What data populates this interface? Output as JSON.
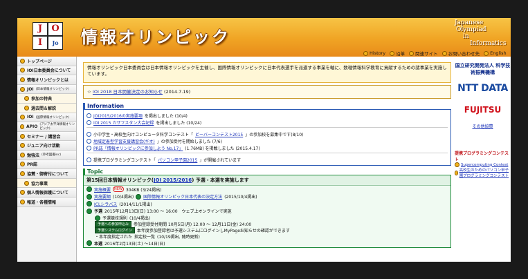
{
  "header": {
    "logo_letters": [
      "J",
      "O",
      "I"
    ],
    "logo_small": "Jo",
    "site_title": "情報オリンピック",
    "en_title": [
      "Japanese",
      "Olympiad",
      "in",
      "Informatics"
    ]
  },
  "topnav": [
    "History",
    "沿革",
    "関連サイト",
    "お問い合わせ先",
    "English"
  ],
  "sidebar": {
    "items": [
      {
        "label": "トップページ",
        "sub": false
      },
      {
        "label": "IOI日本委員会について",
        "sub": false
      },
      {
        "label": "情報オリンピックとは",
        "sub": false
      },
      {
        "label": "JOI",
        "small": "(日本情報オリンピック)",
        "sub": false
      },
      {
        "label": "参加の特典",
        "sub": true
      },
      {
        "label": "過去問＆解説",
        "sub": true
      },
      {
        "label": "IOI",
        "small": "(国際情報オリンピック)",
        "sub": false
      },
      {
        "label": "APIO",
        "small": "(アジア太平洋情報オリンピック)",
        "sub": false
      },
      {
        "label": "セミナー / 講習会",
        "sub": false
      },
      {
        "label": "ジュニア向け活動",
        "sub": false
      },
      {
        "label": "勉強法",
        "small": "(参考図書inc)",
        "sub": false
      },
      {
        "label": "PR誌",
        "sub": false
      },
      {
        "label": "協賛・御寄付について",
        "sub": false
      },
      {
        "label": "協力事業",
        "sub": true
      },
      {
        "label": "個人情報保護について",
        "sub": false
      },
      {
        "label": "報道・各種情報",
        "sub": false
      }
    ]
  },
  "intro": "情報オリンピック日本委員会は日本情報オリンピックを主催し、国際情報オリンピックに日本代表選手を派遣する事業を軸に、数理情報科学教育に貢献するための諸事業を実施しています。",
  "news": {
    "prefix": "☆",
    "link": "IOI 2018 日本開催決定のお知らせ",
    "date": "(2014.7.19)"
  },
  "information": {
    "title": "Information",
    "rows": [
      {
        "link": "JOI2015/2016の実施要項",
        "text": "を掲出しました (10/4)"
      },
      {
        "link": "IOI 2015 カザフスタン大会記録",
        "text": "を掲出しました (10/24)"
      },
      {
        "text": "小中学生・高校生向けコンピュータ科学コンテスト「",
        "link": "ビーバーコンテスト2015",
        "text2": "」の参加校を募集中です(8/10)"
      },
      {
        "link": "地域定着型学習支援講習会(ギオ)",
        "text": "」の参加受付を開始しました (7/6)"
      },
      {
        "link": "PR誌「情報オリンピックに参加しよう No.17」",
        "text": "(1.76MB) を掲載しました (2015.4.17)"
      },
      {
        "text": "提携プログラミングコンテスト「",
        "link": "パソコン甲子園2015",
        "text2": "」が開催されています"
      }
    ]
  },
  "topic": {
    "title": "Topic",
    "headline_pre": "第15回日本情報オリンピック(",
    "headline_link": "JOI 2015/2016",
    "headline_post": ") 予選・本選を実施します",
    "rows": [
      {
        "link": "実施概要",
        "new": "NEW",
        "text": "304KB (3/24掲出)"
      },
      {
        "link": "実施要綱",
        "text": "(10/4掲出)",
        "link2": "国際情報オリンピック日本代表の決定方法",
        "text2": "(2015/10/4掲出)"
      },
      {
        "link": "ICLシラバス",
        "text": "(2014/11/1掲出)"
      },
      {
        "label": "予選",
        "text": "2015年12月13日(日) 13:00 ～ 16:00　ウェブ上オンラインで実施"
      }
    ],
    "subrows": [
      {
        "link": "予選競技規則",
        "text": "(10/4掲出)"
      },
      {
        "badge": "予選への参加申込み",
        "text": "参加登録受付期間 10月5日(月) 12:00 ～ 12月11日(金) 24:00"
      },
      {
        "badge": "予選システムログイン",
        "text": "本年度参加登録者は予選システムにログインしMyPageお知らせの確認ができます"
      },
      {
        "pre": "・本年度指定された",
        "link": "指定校一覧",
        "text": "(10/19掲出, 随時更新)"
      }
    ],
    "final": {
      "label": "本選",
      "text": "2016年2月13日(土) ～14日(日)"
    }
  },
  "right": {
    "sponsor1": "国立研究開発法人 科学技術振興機構",
    "sponsor2": "NTT DATA",
    "sponsor3": "FUJITSU",
    "other": "その他協賛",
    "pc_head": "提携プログラミングコンテスト",
    "pc_items": [
      "Supercomputing Contest",
      "高校生のためのパソコン甲子園プログラミングコンテスト"
    ]
  }
}
